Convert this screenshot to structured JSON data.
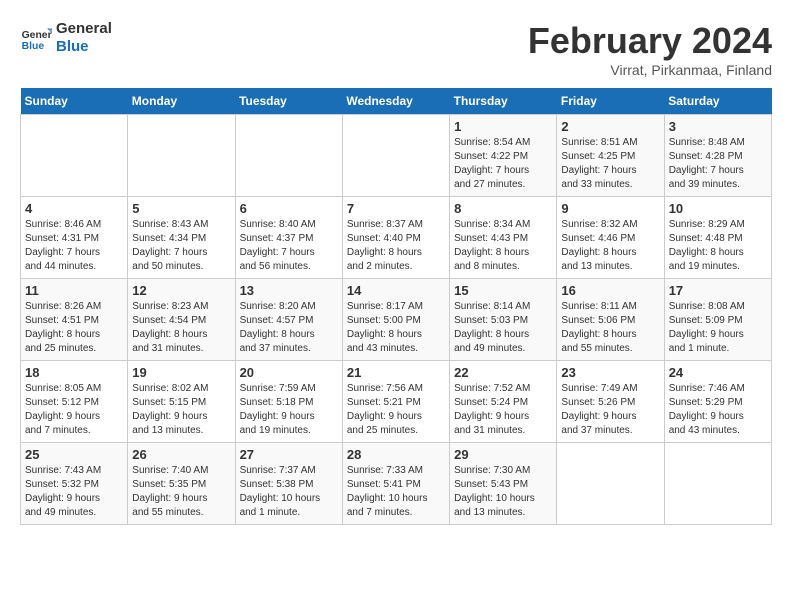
{
  "header": {
    "logo_general": "General",
    "logo_blue": "Blue",
    "month_title": "February 2024",
    "subtitle": "Virrat, Pirkanmaa, Finland"
  },
  "days_of_week": [
    "Sunday",
    "Monday",
    "Tuesday",
    "Wednesday",
    "Thursday",
    "Friday",
    "Saturday"
  ],
  "weeks": [
    [
      {
        "day": "",
        "info": ""
      },
      {
        "day": "",
        "info": ""
      },
      {
        "day": "",
        "info": ""
      },
      {
        "day": "",
        "info": ""
      },
      {
        "day": "1",
        "info": "Sunrise: 8:54 AM\nSunset: 4:22 PM\nDaylight: 7 hours\nand 27 minutes."
      },
      {
        "day": "2",
        "info": "Sunrise: 8:51 AM\nSunset: 4:25 PM\nDaylight: 7 hours\nand 33 minutes."
      },
      {
        "day": "3",
        "info": "Sunrise: 8:48 AM\nSunset: 4:28 PM\nDaylight: 7 hours\nand 39 minutes."
      }
    ],
    [
      {
        "day": "4",
        "info": "Sunrise: 8:46 AM\nSunset: 4:31 PM\nDaylight: 7 hours\nand 44 minutes."
      },
      {
        "day": "5",
        "info": "Sunrise: 8:43 AM\nSunset: 4:34 PM\nDaylight: 7 hours\nand 50 minutes."
      },
      {
        "day": "6",
        "info": "Sunrise: 8:40 AM\nSunset: 4:37 PM\nDaylight: 7 hours\nand 56 minutes."
      },
      {
        "day": "7",
        "info": "Sunrise: 8:37 AM\nSunset: 4:40 PM\nDaylight: 8 hours\nand 2 minutes."
      },
      {
        "day": "8",
        "info": "Sunrise: 8:34 AM\nSunset: 4:43 PM\nDaylight: 8 hours\nand 8 minutes."
      },
      {
        "day": "9",
        "info": "Sunrise: 8:32 AM\nSunset: 4:46 PM\nDaylight: 8 hours\nand 13 minutes."
      },
      {
        "day": "10",
        "info": "Sunrise: 8:29 AM\nSunset: 4:48 PM\nDaylight: 8 hours\nand 19 minutes."
      }
    ],
    [
      {
        "day": "11",
        "info": "Sunrise: 8:26 AM\nSunset: 4:51 PM\nDaylight: 8 hours\nand 25 minutes."
      },
      {
        "day": "12",
        "info": "Sunrise: 8:23 AM\nSunset: 4:54 PM\nDaylight: 8 hours\nand 31 minutes."
      },
      {
        "day": "13",
        "info": "Sunrise: 8:20 AM\nSunset: 4:57 PM\nDaylight: 8 hours\nand 37 minutes."
      },
      {
        "day": "14",
        "info": "Sunrise: 8:17 AM\nSunset: 5:00 PM\nDaylight: 8 hours\nand 43 minutes."
      },
      {
        "day": "15",
        "info": "Sunrise: 8:14 AM\nSunset: 5:03 PM\nDaylight: 8 hours\nand 49 minutes."
      },
      {
        "day": "16",
        "info": "Sunrise: 8:11 AM\nSunset: 5:06 PM\nDaylight: 8 hours\nand 55 minutes."
      },
      {
        "day": "17",
        "info": "Sunrise: 8:08 AM\nSunset: 5:09 PM\nDaylight: 9 hours\nand 1 minute."
      }
    ],
    [
      {
        "day": "18",
        "info": "Sunrise: 8:05 AM\nSunset: 5:12 PM\nDaylight: 9 hours\nand 7 minutes."
      },
      {
        "day": "19",
        "info": "Sunrise: 8:02 AM\nSunset: 5:15 PM\nDaylight: 9 hours\nand 13 minutes."
      },
      {
        "day": "20",
        "info": "Sunrise: 7:59 AM\nSunset: 5:18 PM\nDaylight: 9 hours\nand 19 minutes."
      },
      {
        "day": "21",
        "info": "Sunrise: 7:56 AM\nSunset: 5:21 PM\nDaylight: 9 hours\nand 25 minutes."
      },
      {
        "day": "22",
        "info": "Sunrise: 7:52 AM\nSunset: 5:24 PM\nDaylight: 9 hours\nand 31 minutes."
      },
      {
        "day": "23",
        "info": "Sunrise: 7:49 AM\nSunset: 5:26 PM\nDaylight: 9 hours\nand 37 minutes."
      },
      {
        "day": "24",
        "info": "Sunrise: 7:46 AM\nSunset: 5:29 PM\nDaylight: 9 hours\nand 43 minutes."
      }
    ],
    [
      {
        "day": "25",
        "info": "Sunrise: 7:43 AM\nSunset: 5:32 PM\nDaylight: 9 hours\nand 49 minutes."
      },
      {
        "day": "26",
        "info": "Sunrise: 7:40 AM\nSunset: 5:35 PM\nDaylight: 9 hours\nand 55 minutes."
      },
      {
        "day": "27",
        "info": "Sunrise: 7:37 AM\nSunset: 5:38 PM\nDaylight: 10 hours\nand 1 minute."
      },
      {
        "day": "28",
        "info": "Sunrise: 7:33 AM\nSunset: 5:41 PM\nDaylight: 10 hours\nand 7 minutes."
      },
      {
        "day": "29",
        "info": "Sunrise: 7:30 AM\nSunset: 5:43 PM\nDaylight: 10 hours\nand 13 minutes."
      },
      {
        "day": "",
        "info": ""
      },
      {
        "day": "",
        "info": ""
      }
    ]
  ]
}
